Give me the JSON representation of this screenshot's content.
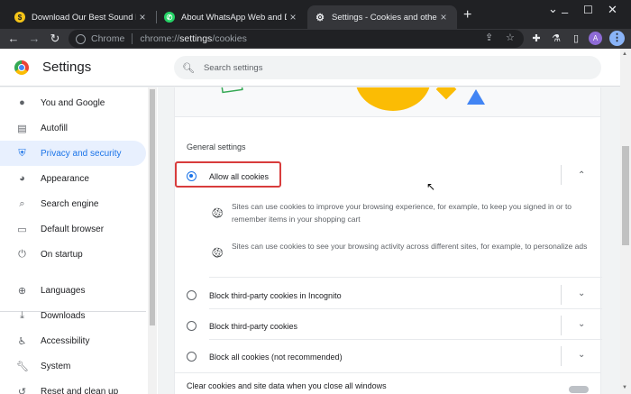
{
  "browser": {
    "tabs": [
      {
        "title": "Download Our Best Sound Effect",
        "favicon": "sound-favicon"
      },
      {
        "title": "About WhatsApp Web and Deskt",
        "favicon": "whatsapp-favicon"
      },
      {
        "title": "Settings - Cookies and other site",
        "favicon": "gear-icon"
      }
    ],
    "omnibox": {
      "chip": "Chrome",
      "url_scheme": "chrome://",
      "url_host": "settings",
      "url_path": "/cookies"
    },
    "profile_initial": "A"
  },
  "settings": {
    "app_title": "Settings",
    "search_placeholder": "Search settings",
    "sidebar": {
      "items": [
        {
          "label": "You and Google",
          "icon": "person-icon"
        },
        {
          "label": "Autofill",
          "icon": "clipboard-icon"
        },
        {
          "label": "Privacy and security",
          "icon": "shield-icon",
          "active": true
        },
        {
          "label": "Appearance",
          "icon": "palette-icon"
        },
        {
          "label": "Search engine",
          "icon": "search-icon"
        },
        {
          "label": "Default browser",
          "icon": "browser-icon"
        },
        {
          "label": "On startup",
          "icon": "power-icon"
        },
        {
          "label": "Languages",
          "icon": "globe-icon"
        },
        {
          "label": "Downloads",
          "icon": "download-icon"
        },
        {
          "label": "Accessibility",
          "icon": "accessibility-icon"
        },
        {
          "label": "System",
          "icon": "wrench-icon"
        },
        {
          "label": "Reset and clean up",
          "icon": "reset-icon"
        }
      ]
    },
    "cookies": {
      "section_label": "General settings",
      "options": [
        {
          "label": "Allow all cookies",
          "checked": true,
          "expanded": true
        },
        {
          "label": "Block third-party cookies in Incognito",
          "checked": false
        },
        {
          "label": "Block third-party cookies",
          "checked": false
        },
        {
          "label": "Block all cookies (not recommended)",
          "checked": false
        }
      ],
      "descriptions": [
        "Sites can use cookies to improve your browsing experience, for example, to keep you signed in or to remember items in your shopping cart",
        "Sites can use cookies to see your browsing activity across different sites, for example, to personalize ads"
      ],
      "clear_on_close_label": "Clear cookies and site data when you close all windows"
    }
  },
  "colors": {
    "accent": "#1a73e8",
    "highlight_box": "#d83c3c"
  }
}
